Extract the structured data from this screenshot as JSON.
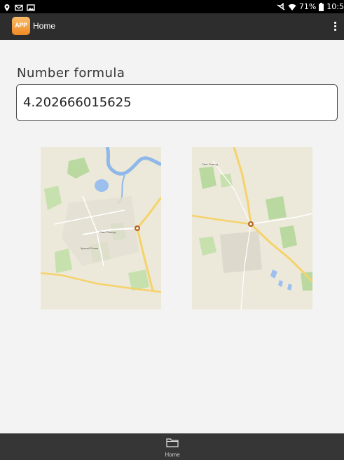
{
  "status_bar": {
    "icons_left": [
      "location-icon",
      "mail-icon",
      "image-icon"
    ],
    "icons_right": [
      "mute-icon",
      "wifi-icon"
    ],
    "battery_text": "71%",
    "time": "10:5"
  },
  "app_bar": {
    "logo_text": "APP",
    "title": "Home",
    "menu_icon": "overflow-menu-icon"
  },
  "form": {
    "label": "Number formula",
    "value": "4.202666015625"
  },
  "maps": [
    {
      "name": "map-tile-left",
      "labels": [
        "Краснії Резаи",
        "Свет Рангод"
      ]
    },
    {
      "name": "map-tile-right",
      "labels": [
        "Свет Рангод"
      ]
    }
  ],
  "bottom_nav": {
    "items": [
      {
        "label": "Home",
        "icon": "folder-icon"
      }
    ]
  },
  "colors": {
    "status_bar": "#000000",
    "app_bar": "#2d2d2d",
    "logo": "#f08a24",
    "bottom_bar": "#363636",
    "background": "#f3f3f3"
  }
}
